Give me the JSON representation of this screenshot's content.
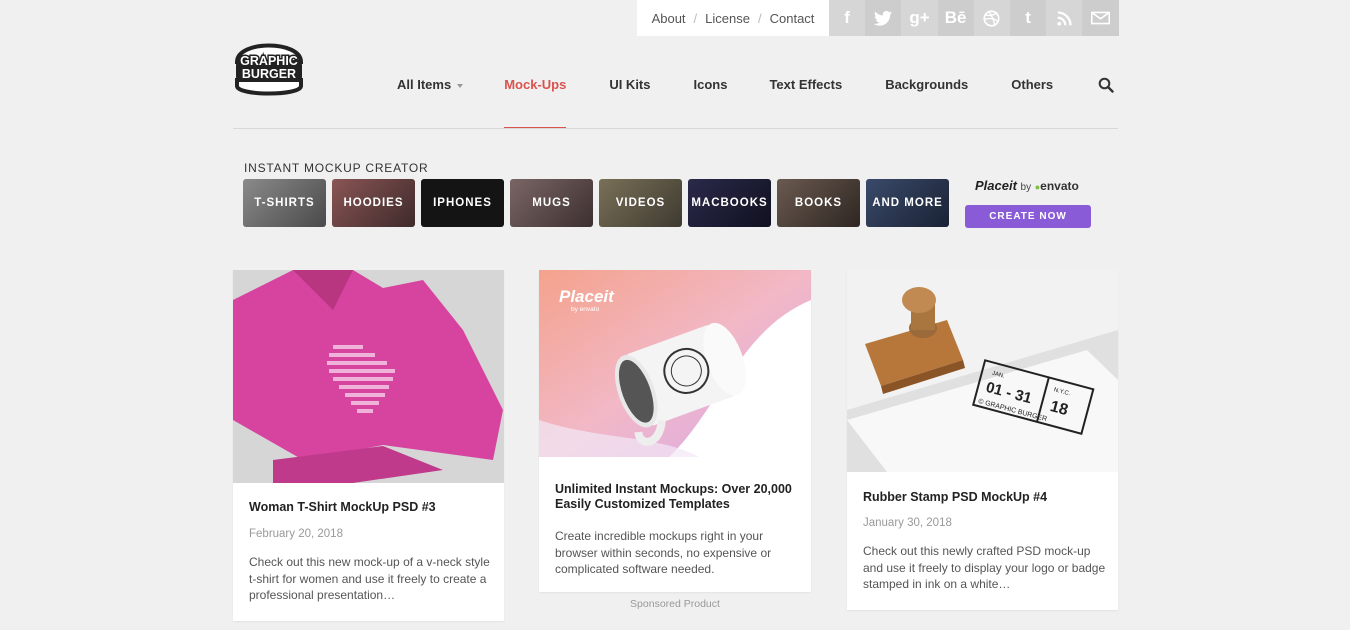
{
  "top_links": [
    "About",
    "License",
    "Contact"
  ],
  "social_icons": [
    "facebook-icon",
    "twitter-icon",
    "google-plus-icon",
    "behance-icon",
    "dribbble-icon",
    "tumblr-icon",
    "rss-icon",
    "email-icon"
  ],
  "social_glyphs": [
    "f",
    "t",
    "g+",
    "Bē",
    "◎",
    "t",
    "◢",
    "✉"
  ],
  "logo": {
    "line1": "GRAPHIC",
    "line2": "BURGER"
  },
  "nav": {
    "items": [
      "All Items",
      "Mock-Ups",
      "UI Kits",
      "Icons",
      "Text Effects",
      "Backgrounds",
      "Others"
    ],
    "active": "Mock-Ups"
  },
  "creator": {
    "title": "INSTANT MOCKUP CREATOR",
    "tiles": [
      "T-SHIRTS",
      "HOODIES",
      "IPHONES",
      "MUGS",
      "VIDEOS",
      "MACBOOKS",
      "BOOKS",
      "AND MORE"
    ],
    "brand": "Placeit",
    "by": "by",
    "envato": "envato",
    "cta": "CREATE NOW"
  },
  "cards": [
    {
      "title": "Woman T-Shirt MockUp PSD #3",
      "date": "February 20, 2018",
      "desc": "Check out this new mock-up of a v-neck style t-shirt for women and use it freely to create a professional presentation…"
    },
    {
      "title": "Unlimited Instant Mockups: Over 20,000 Easily Customized Templates",
      "desc": "Create incredible mockups right in your browser within seconds, no expensive or complicated software needed.",
      "brand": "Placeit",
      "brand_sub": "by envato"
    },
    {
      "title": "Rubber Stamp PSD MockUp #4",
      "date": "January 30, 2018",
      "desc": "Check out this newly crafted PSD mock-up and use it freely to display your logo or badge stamped in ink on a white…",
      "stamp": {
        "month": "JAN.",
        "dates": "01 - 31",
        "city": "N.Y.C.",
        "year": "18",
        "brand": "© GRAPHIC BURGER"
      }
    }
  ],
  "sponsored": "Sponsored Product",
  "colors": {
    "accent": "#d9534f",
    "cta": "#8a5bd6",
    "tshirt": "#d6449f"
  }
}
